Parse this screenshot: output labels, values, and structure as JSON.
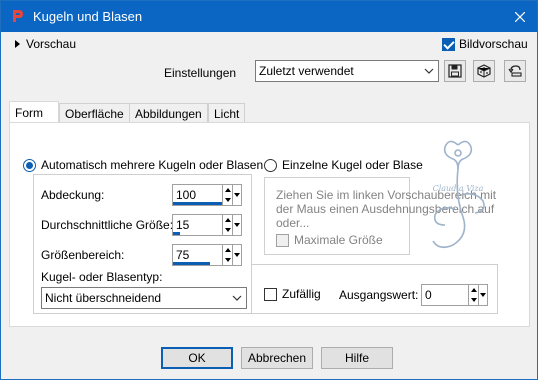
{
  "window": {
    "title": "Kugeln und Blasen"
  },
  "preview": {
    "label": "Vorschau"
  },
  "bildvorschau": {
    "label": "Bildvorschau",
    "checked": true
  },
  "settings": {
    "label": "Einstellungen",
    "value": "Zuletzt verwendet"
  },
  "tabs": [
    {
      "label": "Form"
    },
    {
      "label": "Oberfläche"
    },
    {
      "label": "Abbildungen"
    },
    {
      "label": "Licht"
    }
  ],
  "form": {
    "auto": {
      "label": "Automatisch mehrere Kugeln oder Blasen",
      "fields": {
        "abdeckung": {
          "label": "Abdeckung:",
          "value": "100",
          "fill": 1.0
        },
        "groesse": {
          "label": "Durchschnittliche Größe:",
          "value": "15",
          "fill": 0.15
        },
        "bereich": {
          "label": "Größenbereich:",
          "value": "75",
          "fill": 0.75
        }
      },
      "type_label": "Kugel- oder Blasentyp:",
      "type_value": "Nicht überschneidend"
    },
    "single": {
      "label": "Einzelne Kugel oder Blase",
      "hint": "Ziehen Sie im linken Vorschaubereich mit der Maus einen Ausdehnungsbereich auf oder...",
      "max_label": "Maximale Größe"
    },
    "random_label": "Zufällig",
    "seed_label": "Ausgangswert:",
    "seed_value": "0"
  },
  "buttons": {
    "ok": "OK",
    "cancel": "Abbrechen",
    "help": "Hilfe"
  },
  "watermark": {
    "text": "Claudia Viza"
  },
  "colors": {
    "accent": "#0a5fb4",
    "titlebar": "#0a66c2"
  }
}
